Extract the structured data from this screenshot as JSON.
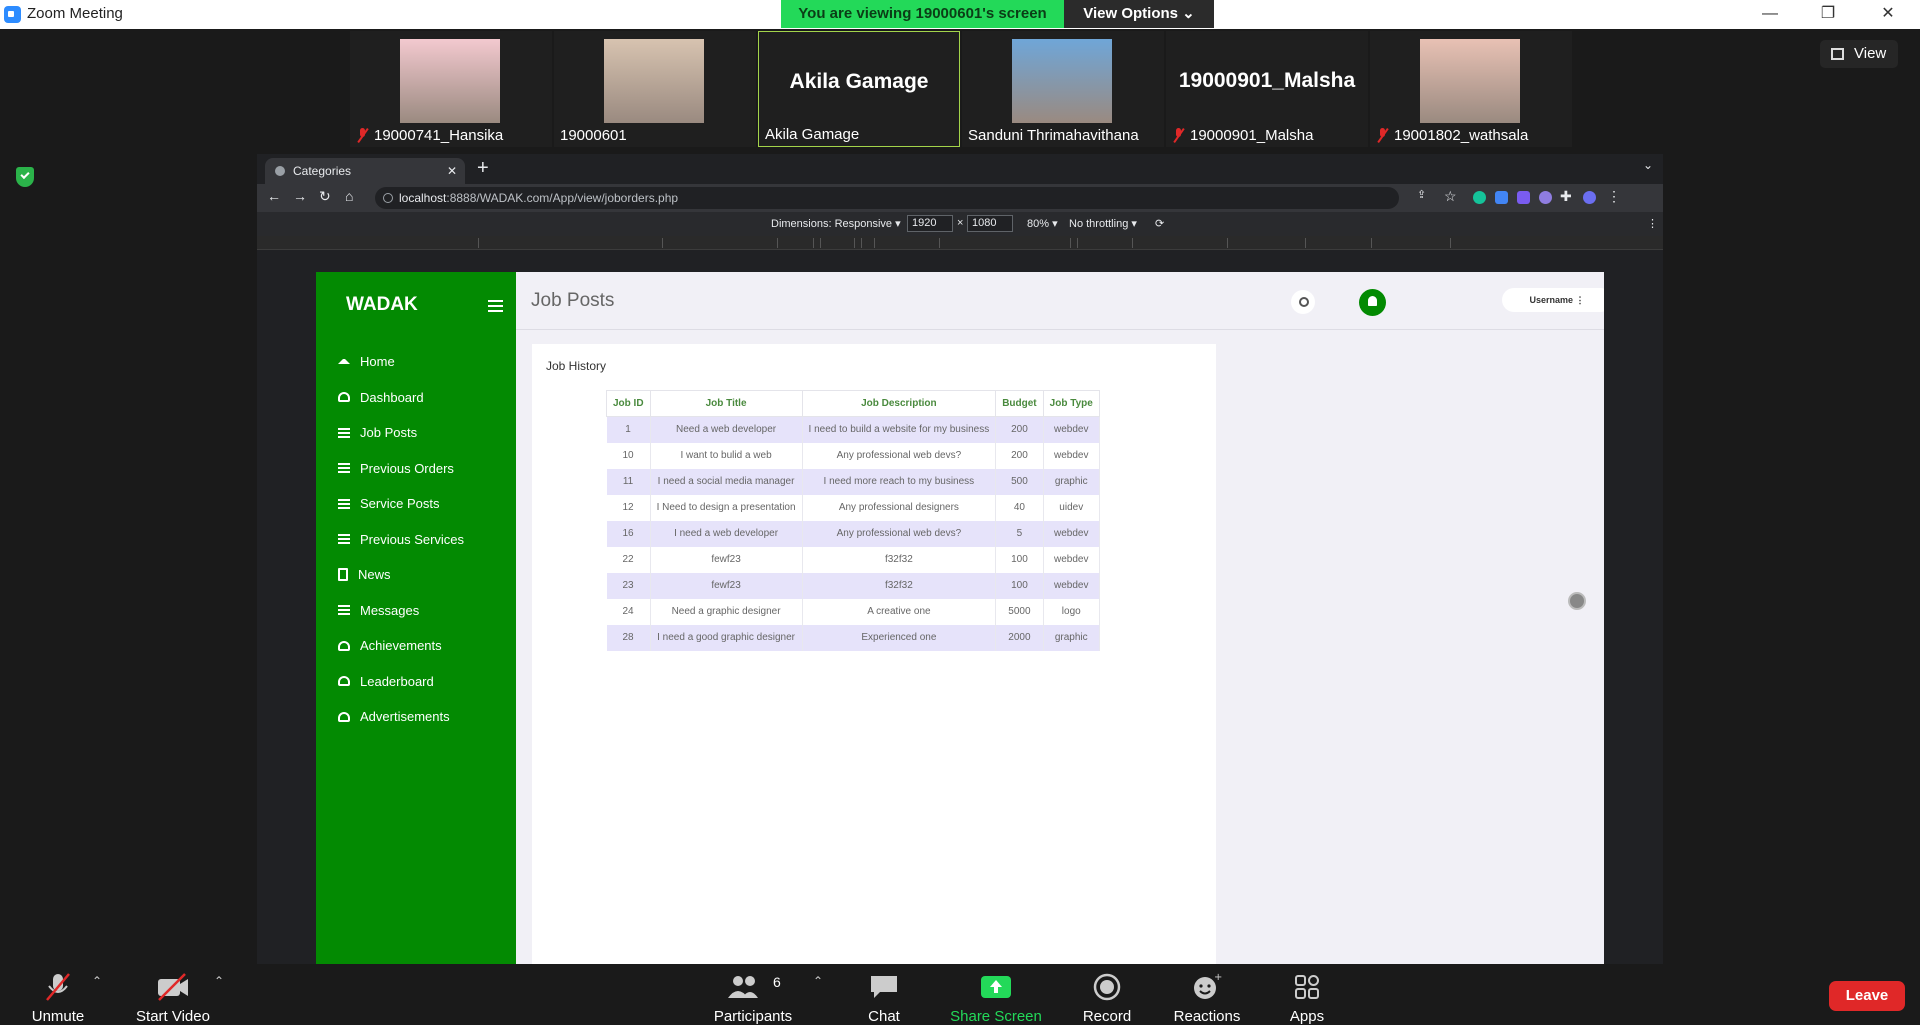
{
  "zoom": {
    "window_title": "Zoom Meeting",
    "viewing_banner": "You are viewing 19000601's screen",
    "view_options": "View Options",
    "view_label": "View",
    "participants": [
      {
        "name": "19000741_Hansika",
        "muted": true,
        "video": true
      },
      {
        "name": "19000601",
        "muted": false,
        "video": true
      },
      {
        "name": "Akila Gamage",
        "big_name": "Akila Gamage",
        "muted": false,
        "video": false,
        "active": true
      },
      {
        "name": "Sanduni Thrimahavithana",
        "muted": false,
        "video": true
      },
      {
        "name": "19000901_Malsha",
        "big_name": "19000901_Malsha",
        "muted": true,
        "video": false
      },
      {
        "name": "19001802_wathsala",
        "muted": true,
        "video": true
      }
    ],
    "toolbar": {
      "unmute": "Unmute",
      "start_video": "Start Video",
      "participants": "Participants",
      "participants_count": "6",
      "chat": "Chat",
      "share_screen": "Share Screen",
      "record": "Record",
      "reactions": "Reactions",
      "apps": "Apps",
      "leave": "Leave"
    },
    "colors": {
      "share_green": "#23d959",
      "leave_red": "#e02828"
    }
  },
  "browser": {
    "tab_title": "Categories",
    "url_host": "localhost",
    "url_rest": ":8888/WADAK.com/App/view/joborders.php",
    "devtools": {
      "dimensions": "Dimensions: Responsive ▾",
      "width": "1920",
      "times": "×",
      "height": "1080",
      "zoom": "80% ▾",
      "throttling": "No throttling ▾"
    }
  },
  "app": {
    "brand": "WADAK",
    "page_title": "Job Posts",
    "username": "Username",
    "brand_color": "#038a02",
    "menu": [
      {
        "label": "Home",
        "icon": "home-icon"
      },
      {
        "label": "Dashboard",
        "icon": "gauge-icon"
      },
      {
        "label": "Job Posts",
        "icon": "list-icon"
      },
      {
        "label": "Previous Orders",
        "icon": "list-icon"
      },
      {
        "label": "Service Posts",
        "icon": "list-icon"
      },
      {
        "label": "Previous Services",
        "icon": "list-icon"
      },
      {
        "label": "News",
        "icon": "newspaper-icon"
      },
      {
        "label": "Messages",
        "icon": "list-icon"
      },
      {
        "label": "Achievements",
        "icon": "gauge-icon"
      },
      {
        "label": "Leaderboard",
        "icon": "gauge-icon"
      },
      {
        "label": "Advertisements",
        "icon": "gauge-icon"
      }
    ],
    "job_history": {
      "title": "Job History",
      "columns": [
        "Job ID",
        "Job Title",
        "Job Description",
        "Budget",
        "Job Type"
      ],
      "rows": [
        [
          "1",
          "Need a web developer",
          "I need to build a website for my business",
          "200",
          "webdev"
        ],
        [
          "10",
          "I want to bulid a web",
          "Any professional web devs?",
          "200",
          "webdev"
        ],
        [
          "11",
          "I need a social media manager",
          "I need more reach to my business",
          "500",
          "graphic"
        ],
        [
          "12",
          "I Need to design a presentation",
          "Any professional designers",
          "40",
          "uidev"
        ],
        [
          "16",
          "I need a web developer",
          "Any professional web devs?",
          "5",
          "webdev"
        ],
        [
          "22",
          "fewf23",
          "f32f32",
          "100",
          "webdev"
        ],
        [
          "23",
          "fewf23",
          "f32f32",
          "100",
          "webdev"
        ],
        [
          "24",
          "Need a graphic designer",
          "A creative one",
          "5000",
          "logo"
        ],
        [
          "28",
          "I need a good graphic designer",
          "Experienced one",
          "2000",
          "graphic"
        ]
      ]
    }
  }
}
